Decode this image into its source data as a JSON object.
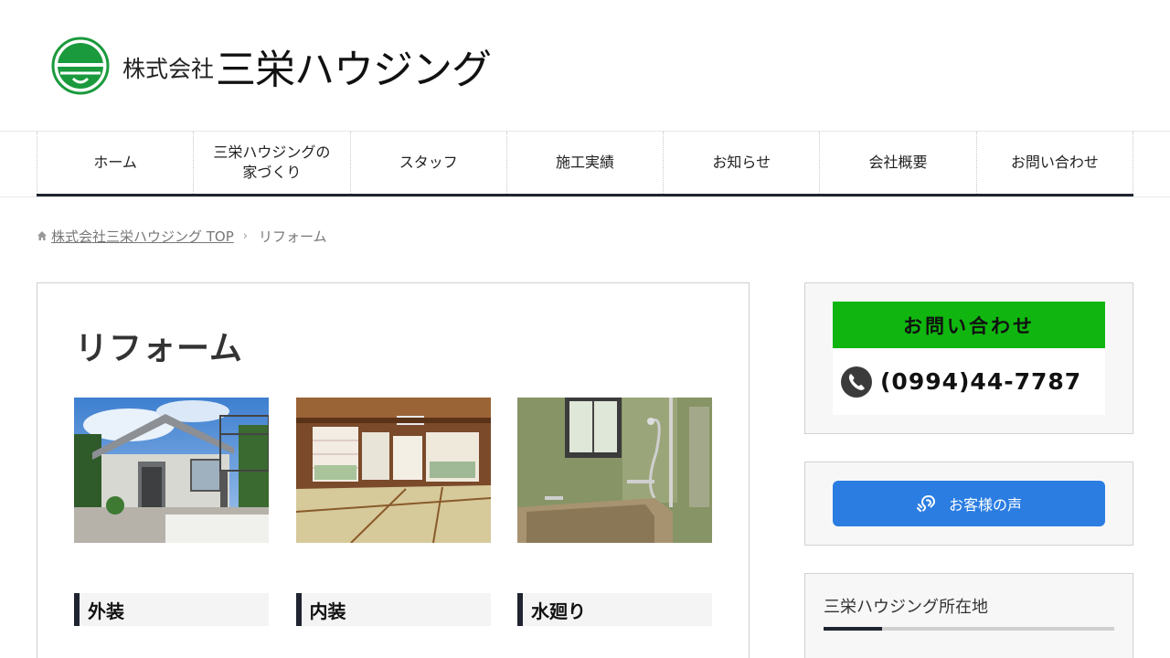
{
  "header": {
    "company_prefix": "株式会社",
    "company_name": "三栄ハウジング",
    "logo_color": "#1a9a3c"
  },
  "nav": {
    "items": [
      {
        "label": "ホーム"
      },
      {
        "label_line1": "三栄ハウジングの",
        "label_line2": "家づくり"
      },
      {
        "label": "スタッフ"
      },
      {
        "label": "施工実績"
      },
      {
        "label": "お知らせ"
      },
      {
        "label": "会社概要"
      },
      {
        "label": "お問い合わせ"
      }
    ],
    "accent_color": "#1f2430"
  },
  "breadcrumb": {
    "home_icon": "home-icon",
    "home_label": "株式会社三栄ハウジング TOP",
    "separator": "›",
    "current": "リフォーム"
  },
  "main": {
    "title": "リフォーム",
    "categories": [
      {
        "label": "外装",
        "image": "house-exterior-photo"
      },
      {
        "label": "内装",
        "image": "tatami-room-photo"
      },
      {
        "label": "水廻り",
        "image": "bathroom-photo"
      }
    ]
  },
  "sidebar": {
    "contact": {
      "heading": "お問い合わせ",
      "phone": "(0994)44-7787",
      "heading_bg": "#10b60f",
      "icon": "phone-icon"
    },
    "voice": {
      "label": "お客様の声",
      "icon": "ear-icon",
      "bg": "#2b7de2"
    },
    "location": {
      "title": "三栄ハウジング所在地"
    }
  }
}
